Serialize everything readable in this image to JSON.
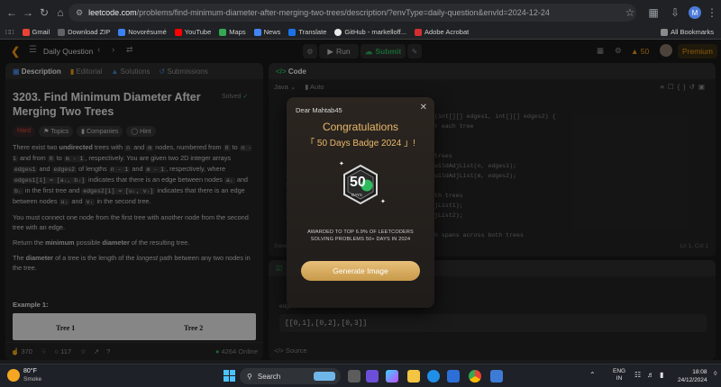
{
  "browser": {
    "url_host": "leetcode.com",
    "url_path": "/problems/find-minimum-diameter-after-merging-two-trees/description/?envType=daily-question&envId=2024-12-24",
    "profile_initial": "M",
    "bookmarks": [
      "Gmail",
      "Download ZIP",
      "Novorésumé",
      "YouTube",
      "Maps",
      "News",
      "Translate",
      "GitHub - markelloff...",
      "Adobe Acrobat"
    ],
    "all_bookmarks": "All Bookmarks"
  },
  "lc_top": {
    "daily_question": "Daily Question",
    "run": "Run",
    "submit": "Submit",
    "streak": "50",
    "premium": "Premium"
  },
  "problem": {
    "tabs": [
      "Description",
      "Editorial",
      "Solutions",
      "Submissions"
    ],
    "title": "3203. Find Minimum Diameter After Merging Two Trees",
    "solved": "Solved",
    "difficulty": "Hard",
    "chips": [
      "Topics",
      "Companies",
      "Hint"
    ],
    "p1_a": "There exist two",
    "p1_b": "undirected",
    "p1_c": "trees with",
    "p1_d": "and",
    "p1_e": "nodes, numbered from",
    "p1_f": "to",
    "p1_g": "and from",
    "p1_h": "to",
    "p1_i": ", respectively. You are given two 2D integer arrays",
    "p1_j": "and",
    "p1_k": "of lengths",
    "p1_l": "and",
    "p1_m": ", respectively, where",
    "p1_n": "indicates that there is an edge between nodes",
    "p1_o": "and",
    "p1_p": "in the first tree and",
    "p1_q": "indicates that there is an edge between nodes",
    "p1_r": "and",
    "p1_s": "in the second tree.",
    "code_n": "n",
    "code_m": "m",
    "code_0": "0",
    "code_n1": "n - 1",
    "code_m1": "m - 1",
    "code_edges1": "edges1",
    "code_edges2": "edges2",
    "code_e1i": "edges1[i] = [aᵢ, bᵢ]",
    "code_e2i": "edges2[i] = [uᵢ, vᵢ]",
    "code_ai": "aᵢ",
    "code_bi": "bᵢ",
    "code_ui": "uᵢ",
    "code_vi": "vᵢ",
    "p2": "You must connect one node from the first tree with another node from the second tree with an edge.",
    "p3_a": "Return the",
    "p3_b": "minimum",
    "p3_c": "possible",
    "p3_d": "diameter",
    "p3_e": "of the resulting tree.",
    "p4_a": "The",
    "p4_b": "diameter",
    "p4_c": "of a tree is the length of the",
    "p4_d": "longest",
    "p4_e": "path between any two nodes in the tree.",
    "example_label": "Example 1:",
    "tree1": "Tree 1",
    "tree2": "Tree 2",
    "likes": "370",
    "comments": "117",
    "online": "4264 Online"
  },
  "editor": {
    "header": "Code",
    "language": "Java",
    "auto": "Auto",
    "lines": [
      "(int[][] edges1, int[][] edges2) {",
      "r each tree",
      "",
      "",
      "trees",
      "uildAdjList(n, edges1);",
      "uildAdjList(m, edges2);",
      "",
      "th trees",
      "jList1);",
      "jList2);",
      "",
      "h spans across both trees"
    ],
    "line_numbers": [
      "1",
      "1",
      "1",
      "1",
      "1"
    ],
    "saved": "Saved",
    "cursor": "Ln 1, Col 1"
  },
  "testcase": {
    "edges_label": "edges1 =",
    "edges_value": "[[0,1],[0,2],[0,3]]",
    "source": "Source"
  },
  "modal": {
    "greeting": "Dear Mahtab45",
    "congrats": "Congratulations",
    "badge": "「 50 Days Badge 2024 」!",
    "badge_number": "50",
    "badge_days": "DAYS",
    "awarded": "AWARDED TO TOP 6.9% OF LEETCODERS SOLVING PROBLEMS 50+ DAYS IN 2024",
    "generate": "Generate Image"
  },
  "taskbar": {
    "temp": "80°F",
    "weather": "Smoke",
    "search": "Search",
    "lang1": "ENG",
    "lang2": "IN",
    "time": "18:08",
    "date": "24/12/2024"
  },
  "colors": {
    "accent_orange": "#ffa116",
    "success_green": "#2cbb5d",
    "hard_red": "#ef4743",
    "gold": "#e9b96a"
  }
}
